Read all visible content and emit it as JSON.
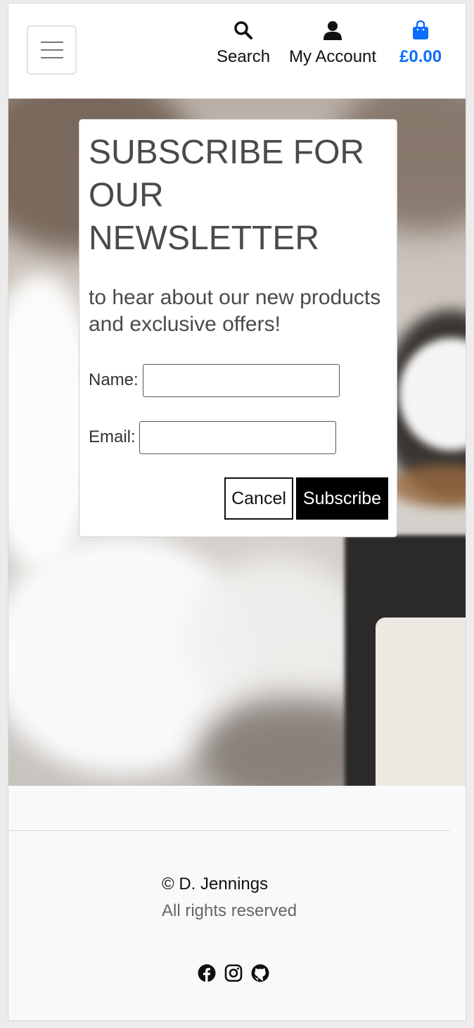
{
  "header": {
    "search_label": "Search",
    "account_label": "My Account",
    "cart_total": "£0.00",
    "accent_color": "#0d6efd"
  },
  "modal": {
    "title": "SUBSCRIBE FOR OUR NEWSLETTER",
    "subtitle": "to hear about our new products and exclusive offers!",
    "name_label": "Name:",
    "name_value": "",
    "email_label": "Email:",
    "email_value": "",
    "cancel_label": "Cancel",
    "subscribe_label": "Subscribe"
  },
  "footer": {
    "copyright": "© D. Jennings",
    "rights": "All rights reserved",
    "social_icons": [
      "facebook-icon",
      "instagram-icon",
      "github-icon"
    ]
  }
}
